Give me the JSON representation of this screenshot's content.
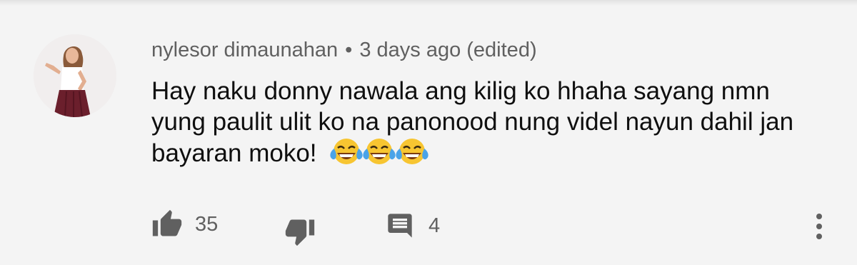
{
  "comment": {
    "author": "nylesor dimaunahan",
    "separator": "•",
    "time": "3 days ago (edited)",
    "text": "Hay naku donny nawala ang kilig ko hhaha sayang nmn yung paulit ulit ko na panonood nung videl nayun dahil jan bayaran moko!",
    "emojis": [
      "face-with-tears-of-joy",
      "face-with-tears-of-joy",
      "face-with-tears-of-joy"
    ]
  },
  "actions": {
    "like_count": "35",
    "reply_count": "4",
    "like_icon": "thumb-up-icon",
    "dislike_icon": "thumb-down-icon",
    "reply_icon": "comment-icon",
    "more_icon": "more-vertical-icon"
  },
  "colors": {
    "background": "#f4f4f4",
    "text": "#0f0f0f",
    "secondary_text": "#606060",
    "icon": "#606060"
  }
}
